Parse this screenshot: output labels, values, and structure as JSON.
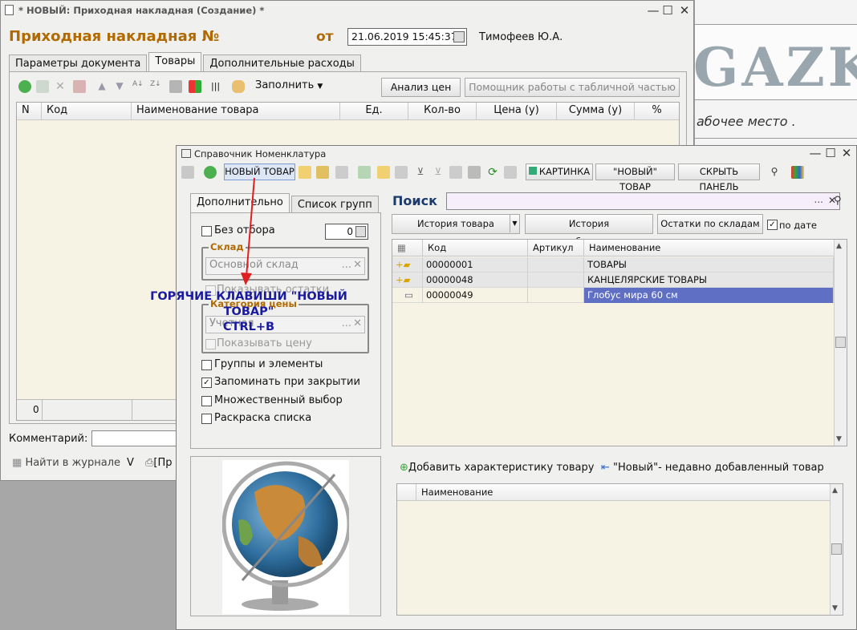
{
  "bg": {
    "brand_text": "GAZK",
    "workspace_text": "абочее место ."
  },
  "main": {
    "title": "* НОВЫЙ: Приходная накладная (Создание) *",
    "doc_title": "Приходная накладная №",
    "from_label": "от",
    "date_value": "21.06.2019 15:45:37",
    "user": "Тимофеев Ю.А.",
    "tabs": [
      "Параметры документа",
      "Товары",
      "Дополнительные расходы"
    ],
    "fill_label": "Заполнить",
    "price_analysis": "Анализ цен",
    "table_helper": "Помощник работы с табличной частью",
    "columns": [
      "N",
      "Код",
      "Наименование товара",
      "Ед.",
      "Кол-во",
      "Цена (у)",
      "Сумма (у)",
      "%"
    ],
    "footer_count": "0",
    "comment_label": "Комментарий:",
    "find_journal": "Найти в журнале",
    "v_label": "V",
    "print_label": "[Пр"
  },
  "ref": {
    "title": "Справочник Номенклатура",
    "new_item": "НОВЫЙ ТОВАР",
    "picture": "КАРТИНКА",
    "new_item_quoted": "\"НОВЫЙ\" ТОВАР",
    "hide_panel": "СКРЫТЬ ПАНЕЛЬ",
    "side_tabs": [
      "Дополнительно",
      "Список групп"
    ],
    "no_filter": "Без отбора",
    "no_filter_value": "0",
    "warehouse_group": "Склад",
    "warehouse_value": "Основной склад",
    "show_stock": "Показывать остатки",
    "price_category": "Категория цены",
    "price_category_value": "Учетная",
    "show_price": "Показывать цену",
    "groups_elements": "Группы и элементы",
    "remember_close": "Запоминать при закрытии",
    "multi_select": "Множественный выбор",
    "coloring": "Раскраска списка",
    "search_label": "Поиск",
    "history_item": "История товара",
    "history_price": "История ценообразования",
    "stock_by_wh": "Остатки по складам",
    "by_date": "по дате",
    "list_columns": [
      "Код",
      "Артикул",
      "Наименование"
    ],
    "rows": [
      {
        "code": "00000001",
        "article": "",
        "name": "ТОВАРЫ"
      },
      {
        "code": "00000048",
        "article": "",
        "name": "КАНЦЕЛЯРСКИЕ ТОВАРЫ"
      },
      {
        "code": "00000049",
        "article": "",
        "name": "Глобус мира 60 см"
      }
    ],
    "add_characteristic": "Добавить характеристику товару",
    "recent_new": "\"Новый\"- недавно добавленный товар",
    "char_column": "Наименование"
  },
  "annotation": {
    "line1": "ГОРЯЧИЕ КЛАВИШИ \"НОВЫЙ",
    "line2": "ТОВАР\"",
    "line3": "CTRL+B"
  }
}
